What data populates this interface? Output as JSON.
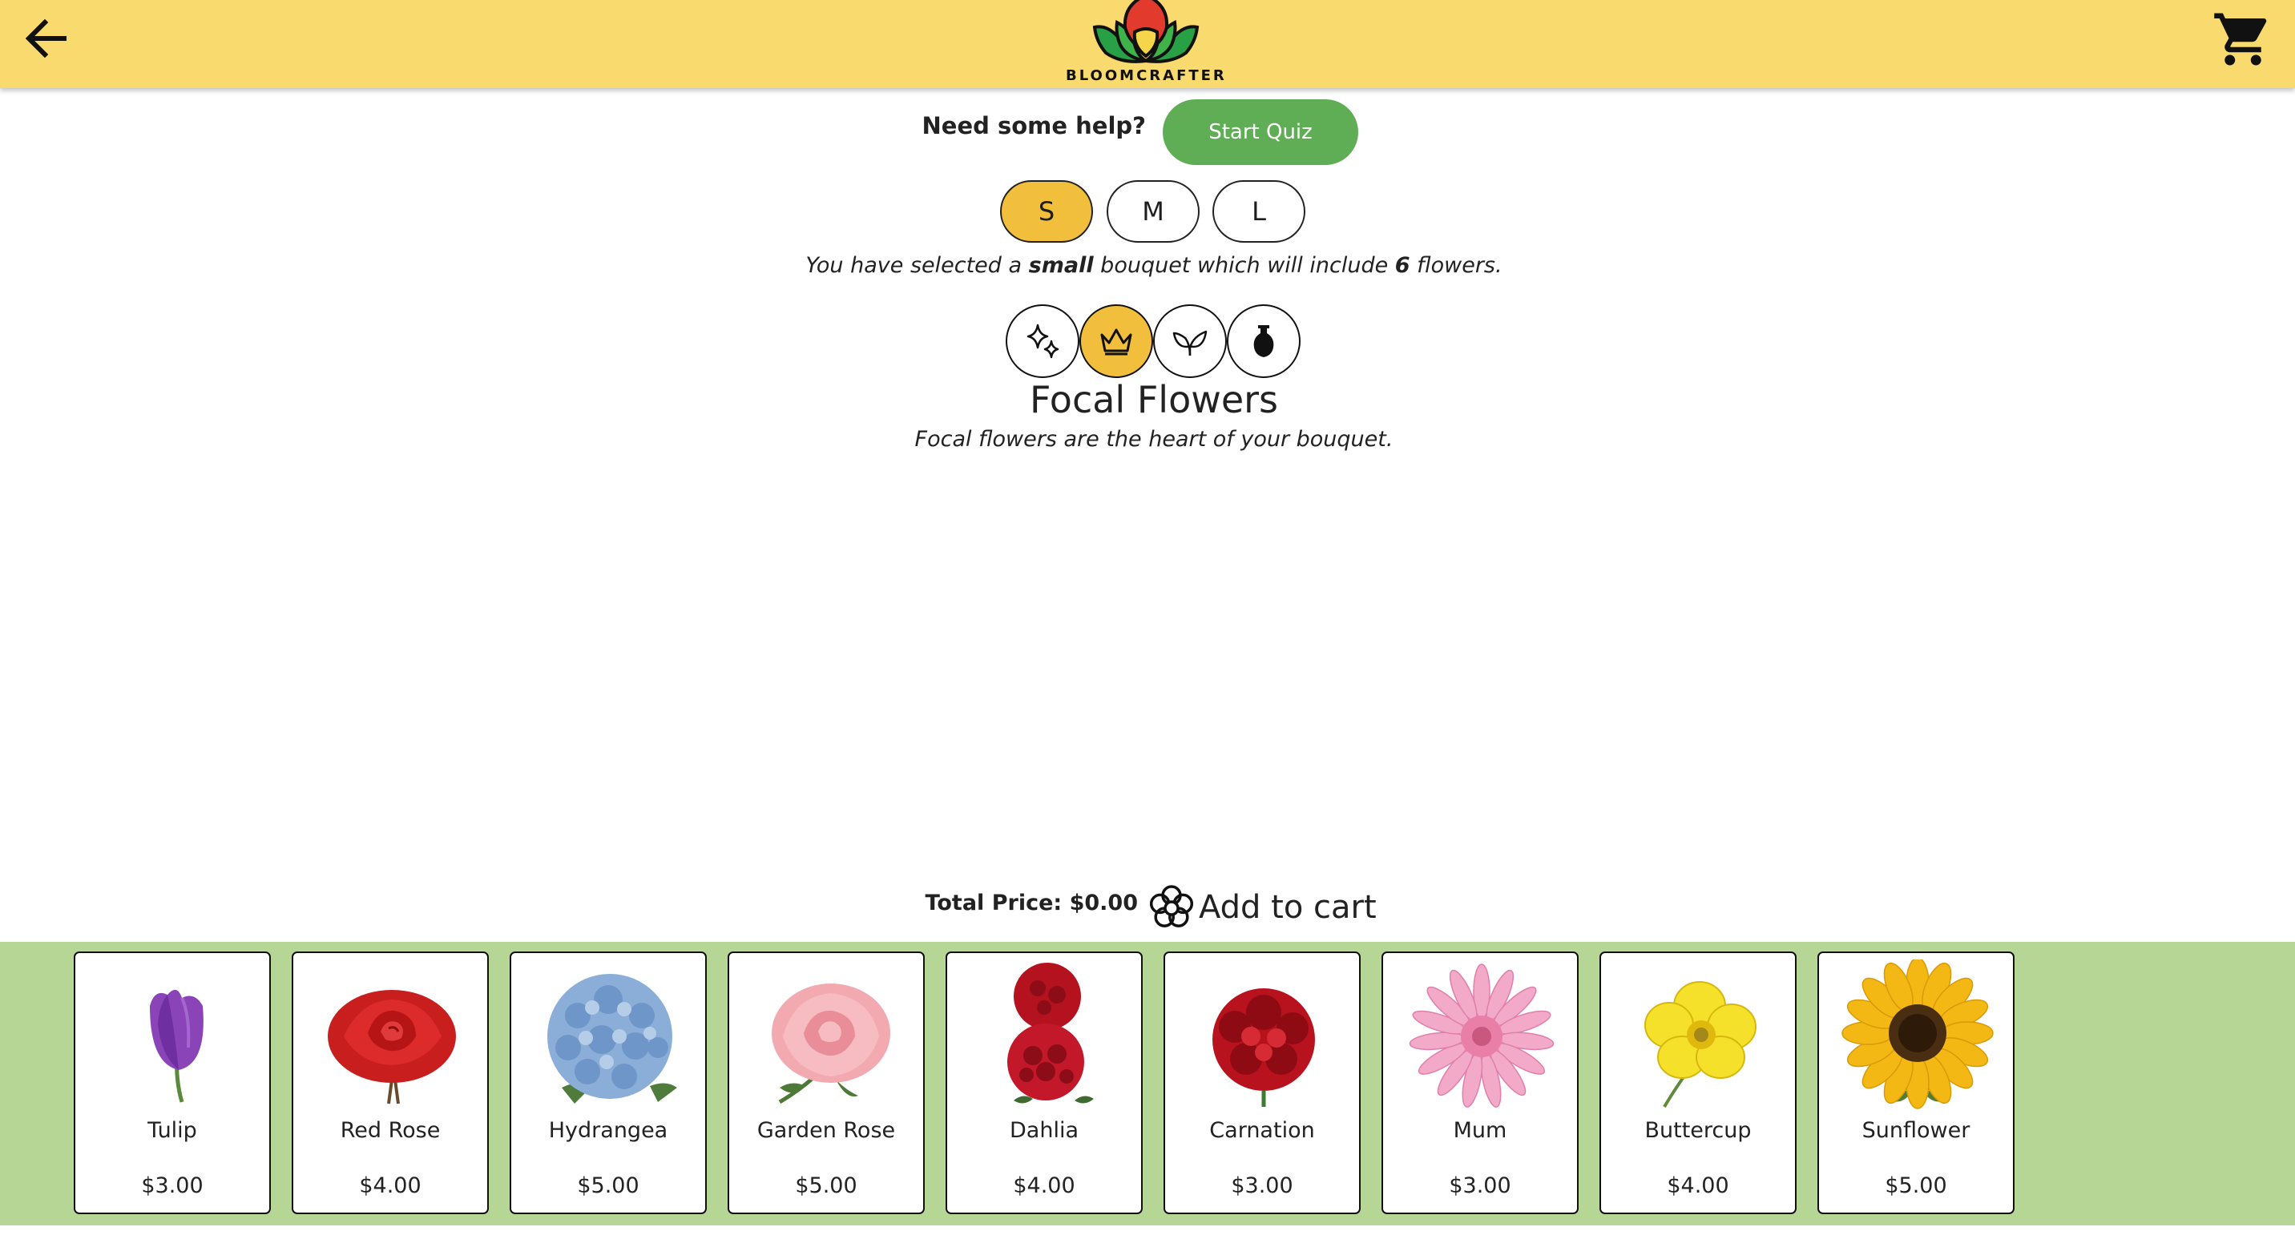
{
  "header": {
    "brand": "BLOOMCRAFTER",
    "back_icon": "arrow-left-icon",
    "cart_icon": "shopping-cart-icon",
    "background_color": "#f8da6e"
  },
  "help": {
    "label": "Need some help?",
    "quiz_button": "Start Quiz",
    "quiz_color": "#5fae55"
  },
  "sizes": {
    "options": [
      "S",
      "M",
      "L"
    ],
    "selected": "S",
    "note_prefix": "You have selected a ",
    "note_size": "small",
    "note_middle": " bouquet which will include ",
    "note_count": "6",
    "note_suffix": " flowers.",
    "active_color": "#f2bf3d"
  },
  "categories": {
    "icons": [
      "sparkles-icon",
      "crown-icon",
      "leaf-icon",
      "vase-icon"
    ],
    "selected_index": 1,
    "title": "Focal Flowers",
    "description": "Focal flowers are the heart of your bouquet."
  },
  "checkout": {
    "total_price": "Total Price: $0.00",
    "add_to_cart": "Add to cart",
    "add_icon": "flower-outline-icon"
  },
  "flowers": [
    {
      "name": "Tulip",
      "price": "$3.00",
      "icon": "tulip-image"
    },
    {
      "name": "Red Rose",
      "price": "$4.00",
      "icon": "red-rose-image"
    },
    {
      "name": "Hydrangea",
      "price": "$5.00",
      "icon": "hydrangea-image"
    },
    {
      "name": "Garden Rose",
      "price": "$5.00",
      "icon": "garden-rose-image"
    },
    {
      "name": "Dahlia",
      "price": "$4.00",
      "icon": "dahlia-image"
    },
    {
      "name": "Carnation",
      "price": "$3.00",
      "icon": "carnation-image"
    },
    {
      "name": "Mum",
      "price": "$3.00",
      "icon": "mum-image"
    },
    {
      "name": "Buttercup",
      "price": "$4.00",
      "icon": "buttercup-image"
    },
    {
      "name": "Sunflower",
      "price": "$5.00",
      "icon": "sunflower-image"
    }
  ],
  "tray_color": "#b6d696"
}
